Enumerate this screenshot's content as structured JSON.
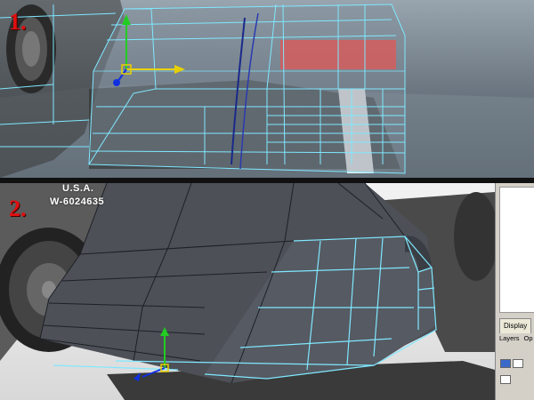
{
  "steps": [
    {
      "label": "1."
    },
    {
      "label": "2."
    }
  ],
  "truck_markings": {
    "line1": "U.S.A.",
    "line2": "W-6024635"
  },
  "panel2_ui": {
    "tab": "Display",
    "menu": [
      "Layers",
      "Op"
    ]
  },
  "colors": {
    "wire": "#7fe8ff",
    "step_number": "#e01010",
    "highlight_face": "#d95a5a",
    "mesh_face": "#4d5057"
  },
  "icons": {
    "move_manipulator": "move-manipulator-icon"
  }
}
